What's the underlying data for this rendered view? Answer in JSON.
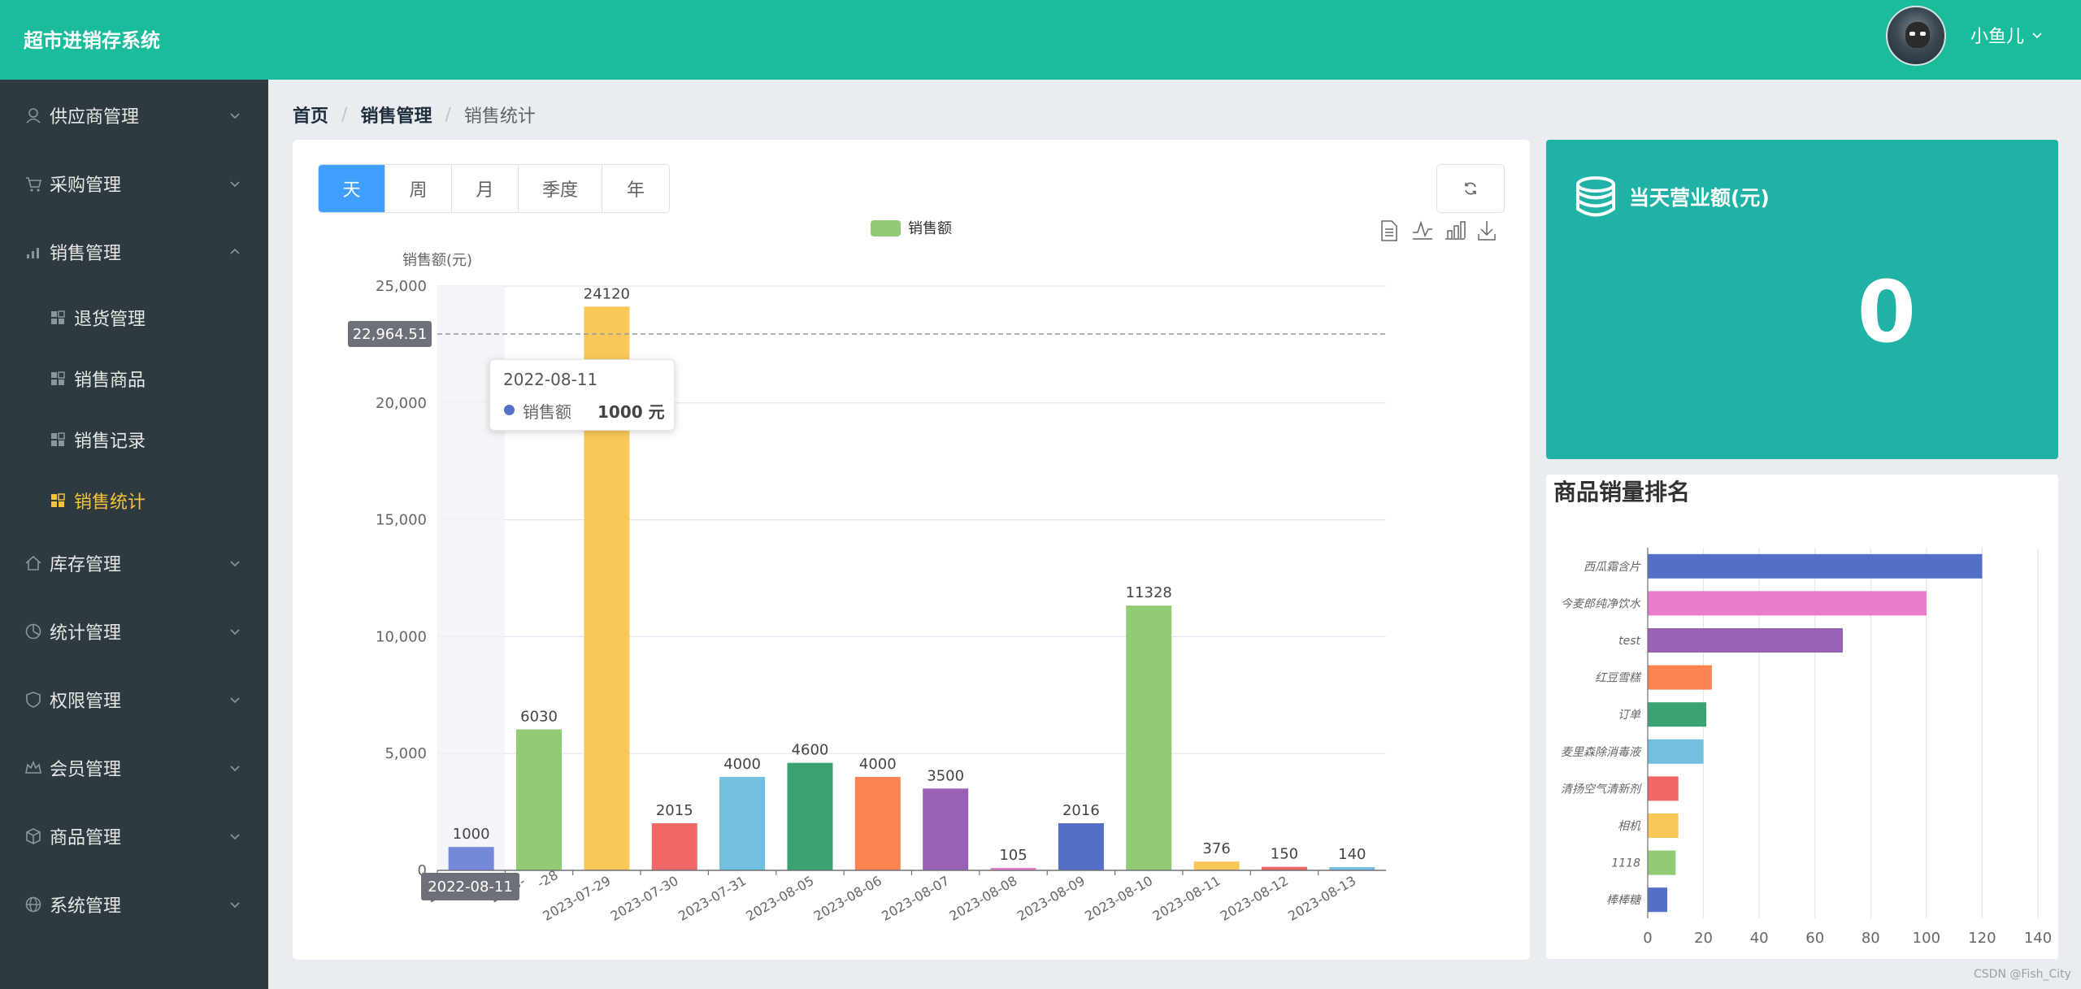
{
  "header": {
    "app_title": "超市进销存系统",
    "user_name": "小鱼儿",
    "avatar_icon": "user-avatar",
    "dropdown_icon": "chevron-down-icon"
  },
  "sidebar": {
    "menus": [
      {
        "label": "供应商管理",
        "icon": "supplier-icon",
        "expanded": false
      },
      {
        "label": "采购管理",
        "icon": "cart-icon",
        "expanded": false
      },
      {
        "label": "销售管理",
        "icon": "signal-icon",
        "expanded": true,
        "children": [
          {
            "label": "退货管理",
            "icon": "grid-icon",
            "active": false
          },
          {
            "label": "销售商品",
            "icon": "grid-icon",
            "active": false
          },
          {
            "label": "销售记录",
            "icon": "grid-icon",
            "active": false
          },
          {
            "label": "销售统计",
            "icon": "grid-icon",
            "active": true
          }
        ]
      },
      {
        "label": "库存管理",
        "icon": "home-icon",
        "expanded": false
      },
      {
        "label": "统计管理",
        "icon": "pie-icon",
        "expanded": false
      },
      {
        "label": "权限管理",
        "icon": "shield-icon",
        "expanded": false
      },
      {
        "label": "会员管理",
        "icon": "crown-icon",
        "expanded": false
      },
      {
        "label": "商品管理",
        "icon": "box-icon",
        "expanded": false
      },
      {
        "label": "系统管理",
        "icon": "globe-icon",
        "expanded": false
      }
    ],
    "active_color": "#f5c33b"
  },
  "breadcrumb": {
    "home": "首页",
    "section": "销售管理",
    "current": "销售统计",
    "separator": "/"
  },
  "period_tabs": {
    "options": [
      "天",
      "周",
      "月",
      "季度",
      "年"
    ],
    "selected": "天"
  },
  "toolbox_icons": [
    "data-view-icon",
    "line-chart-icon",
    "bar-chart-icon",
    "download-icon"
  ],
  "refresh_icon": "refresh-icon",
  "chart_data": [
    {
      "type": "bar",
      "legend": [
        "销售额"
      ],
      "legend_position": "top-center",
      "ylabel": "销售额(元)",
      "ylim": [
        0,
        25000
      ],
      "yticks": [
        "0",
        "5,000",
        "10,000",
        "15,000",
        "20,000",
        "25,000"
      ],
      "categories": [
        "2022-08-11",
        "2023-07-28",
        "2023-07-29",
        "2023-07-30",
        "2023-07-31",
        "2023-08-05",
        "2023-08-06",
        "2023-08-07",
        "2023-08-08",
        "2023-08-09",
        "2023-08-10",
        "2023-08-11",
        "2023-08-12",
        "2023-08-13"
      ],
      "visible_tick_labels": [
        "2022-",
        "2023-",
        "-28",
        "2023-07-29",
        "2023-07-30",
        "2023-07-31",
        "2023-08-05",
        "2023-08-06",
        "2023-08-07",
        "2023-08-08",
        "2023-08-09",
        "2023-08-10",
        "2023-08-11",
        "2023-08-12",
        "2023-08-13"
      ],
      "values": [
        1000,
        6030,
        24120,
        2015,
        4000,
        4600,
        4000,
        3500,
        105,
        2016,
        11328,
        376,
        150,
        140
      ],
      "data_labels": [
        "1000",
        "6030",
        "24120",
        "2015",
        "4000",
        "4600",
        "4000",
        "3500",
        "105",
        "2016",
        "11328",
        "376",
        "150",
        "140"
      ],
      "colors": [
        "#7589d8",
        "#91cc75",
        "#fac858",
        "#ee6666",
        "#73c0de",
        "#3ba272",
        "#fc8452",
        "#9a60b4",
        "#ea7ccc",
        "#5470c6",
        "#91cc75",
        "#fac858",
        "#ee6666",
        "#73c0de"
      ],
      "grid": true,
      "axis_pointer": {
        "y_label": "22,964.51",
        "x_label": "2022-08-11",
        "highlight_index": 0
      },
      "tooltip": {
        "date": "2022-08-11",
        "series": "销售额",
        "value": "1000 元",
        "dot_color": "#5470c6"
      }
    },
    {
      "type": "bar",
      "orientation": "horizontal",
      "categories": [
        "西瓜霜含片",
        "今麦郎纯净饮水",
        "test",
        "红豆雪糕",
        "订单",
        "麦里森除消毒液",
        "清扬空气清新剂",
        "相机",
        "1118",
        "棒棒糖"
      ],
      "values": [
        120,
        100,
        70,
        23,
        21,
        20,
        11,
        11,
        10,
        7
      ],
      "xlim": [
        0,
        140
      ],
      "xticks": [
        "0",
        "20",
        "40",
        "60",
        "80",
        "100",
        "120",
        "140"
      ],
      "colors": [
        "#5470c6",
        "#ea7ccc",
        "#9a60b4",
        "#fc8452",
        "#3ba272",
        "#73c0de",
        "#ee6666",
        "#fac858",
        "#91cc75",
        "#5470c6"
      ],
      "grid": true
    }
  ],
  "revenue_card": {
    "title": "当天营业额(元)",
    "value": "0",
    "icon": "coins-icon",
    "color": "#20b2a5"
  },
  "ranking_card": {
    "title": "商品销量排名"
  },
  "watermark": "CSDN @Fish_City"
}
